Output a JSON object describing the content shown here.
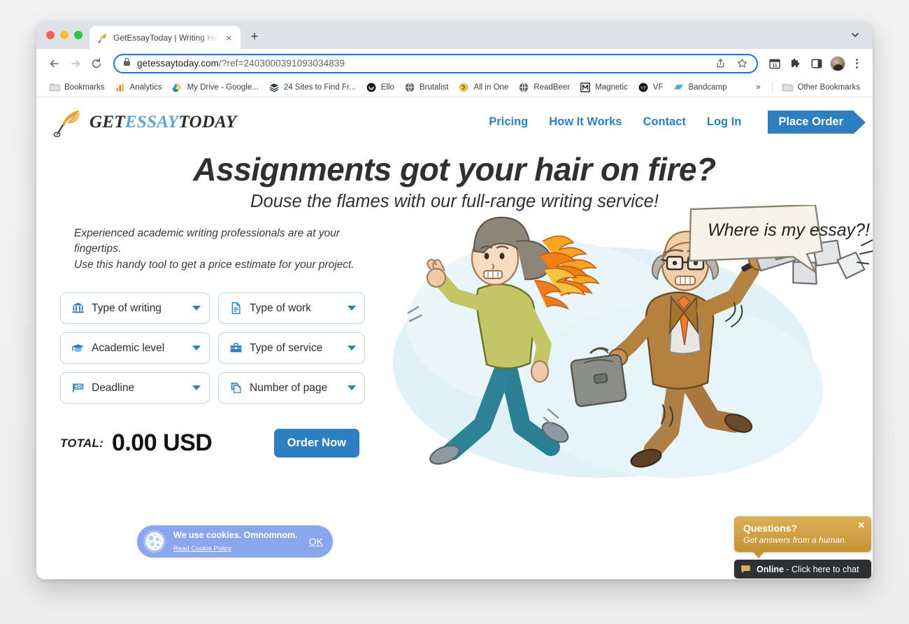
{
  "browser": {
    "tab": {
      "title": "GetEssayToday | Writing Help f",
      "favicon": "quill-flame-icon",
      "close": "×",
      "new_tab": "+"
    },
    "tab_search_icon": "chevron-down-icon",
    "toolbar": {
      "back": "←",
      "forward": "→",
      "reload": "↻",
      "lock_icon": "lock-icon",
      "url_host": "getessaytoday.com",
      "url_path": "/?ref=2403000391093034839",
      "share_icon": "share-icon",
      "bookmark_icon": "star-icon",
      "calendar_icon": "calendar-icon",
      "calendar_day": "11",
      "extensions_icon": "puzzle-icon",
      "side_panel_icon": "side-panel-icon",
      "profile_icon": "avatar-icon",
      "menu_icon": "kebab-menu-icon"
    },
    "bookmarks": [
      {
        "label": "Bookmarks",
        "icon": "folder-icon"
      },
      {
        "label": "Analytics",
        "icon": "analytics-icon"
      },
      {
        "label": "My Drive - Google...",
        "icon": "google-drive-icon"
      },
      {
        "label": "24 Sites to Find Fr...",
        "icon": "layers-icon"
      },
      {
        "label": "Ello",
        "icon": "ello-icon"
      },
      {
        "label": "Brutalist",
        "icon": "globe-icon"
      },
      {
        "label": "All in One",
        "icon": "allinone-icon"
      },
      {
        "label": "ReadBeer",
        "icon": "globe-icon"
      },
      {
        "label": "Magnetic",
        "icon": "magnetic-m-icon"
      },
      {
        "label": "VF",
        "icon": "vf-icon"
      },
      {
        "label": "Bandcamp",
        "icon": "bandcamp-icon"
      }
    ],
    "bookmarks_overflow": "»",
    "other_bookmarks": {
      "label": "Other Bookmarks",
      "icon": "folder-icon"
    }
  },
  "site": {
    "logo": {
      "part1": "GET",
      "part2": "ESSAY",
      "part3": "TODAY",
      "icon": "quill-flame-icon"
    },
    "nav": [
      {
        "label": "Pricing"
      },
      {
        "label": "How It Works"
      },
      {
        "label": "Contact"
      },
      {
        "label": "Log In"
      }
    ],
    "cta": {
      "label": "Place Order"
    },
    "hero": {
      "headline": "Assignments got your hair on fire?",
      "subhead": "Douse the flames with our full-range writing service!",
      "intro_line1": "Experienced academic writing professionals are at your fingertips.",
      "intro_line2": "Use this handy tool to get a price estimate for your project."
    },
    "calculator": {
      "fields": [
        {
          "label": "Type of writing",
          "icon": "bank-columns-icon"
        },
        {
          "label": "Type of work",
          "icon": "document-icon"
        },
        {
          "label": "Academic level",
          "icon": "graduation-cap-icon"
        },
        {
          "label": "Type of service",
          "icon": "briefcase-icon"
        },
        {
          "label": "Deadline",
          "icon": "flag-icon"
        },
        {
          "label": "Number of page",
          "icon": "copy-pages-icon"
        }
      ],
      "total_label": "TOTAL:",
      "total_value": "0.00 USD",
      "order_button": "Order Now"
    },
    "illustration": {
      "speech_bubble": "Where is my essay?!",
      "alt": "woman running with hair on fire chased by angry man waving papers"
    },
    "cookie_banner": {
      "icon": "cookie-icon",
      "message": "We use cookies. Omnomnom.",
      "policy_link": "Read Cookie Policy",
      "ok_button": "OK"
    },
    "chat_widget": {
      "title": "Questions?",
      "subtitle": "Get answers from a human.",
      "close": "✕",
      "status": "Online",
      "status_separator": " - ",
      "action": "Click here to chat",
      "bubble_icon": "speech-bubble-icon"
    }
  },
  "colors": {
    "brand_blue": "#2e7ec1",
    "logo_blue": "#5ba3dc",
    "field_border": "#bcd9ef",
    "cookie_bg": "#8aa6ef",
    "chat_gold": "#c59233",
    "chat_dark": "#2e3033"
  }
}
